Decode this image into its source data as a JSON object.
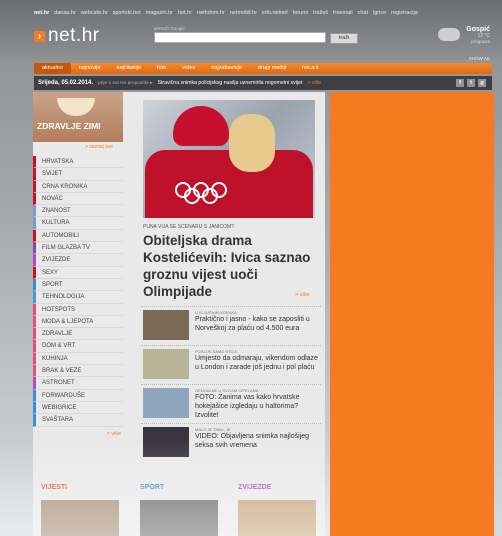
{
  "header": {
    "top_links": [
      "net.hr",
      "danas.hr",
      "webcafe.hr",
      "sportski.net",
      "magazin.hr",
      "hot.hr",
      "nethdom.hr",
      "netmobil.hr",
      "info.netnet",
      "forumi",
      "tražeš",
      "freemail",
      "chat",
      "igrice",
      "registracija"
    ],
    "logo_text": "net.hr",
    "search_label": "pretraži Google",
    "search_placeholder": "",
    "search_button": "traži",
    "weather_city": "Gospić",
    "weather_temp": "12 °C",
    "weather_link": "prognoza",
    "show_ad": "SHOW AD"
  },
  "nav": {
    "tabs": [
      "aktualno",
      "najnovije",
      "najčitanije",
      "foto",
      "video",
      "najzabavnije",
      "drugi mediji",
      "net.a.š"
    ],
    "active_index": 0
  },
  "datebar": {
    "date": "Srijeda, 05.02.2014.",
    "prefix": "prije 1 sat  Ne propustite ▸",
    "headline": "Stravična snimka policijskog nasilja uznemirila nogometni svijet",
    "more": "> više",
    "social": [
      "f",
      "t",
      "g"
    ]
  },
  "promo": {
    "title": "ZDRAVLJE ZIMI",
    "more": "> saznaj sve"
  },
  "sections": {
    "items": [
      "HRVATSKA",
      "SVIJET",
      "CRNA KRONIKA",
      "NOVAC",
      "ZNANOST",
      "KULTURA",
      "AUTOMOBILI",
      "FILM GLAZBA TV",
      "ZVIJEZDE",
      "SEXY",
      "SPORT",
      "TEHNOLOGIJA",
      "HOTSPOTS",
      "MODA & LJEPOTA",
      "ZDRAVLJE",
      "DOM & VRT",
      "KUHINJA",
      "BRAK & VEZE",
      "ASTRONET",
      "FORWARDUŠE",
      "WEBIGRICE",
      "SVAŠTARA"
    ],
    "colors": [
      "#d0101f",
      "#d0101f",
      "#d0101f",
      "#d0101f",
      "#7b9bd0",
      "#7b9bd0",
      "#d0101f",
      "#8a48b5",
      "#b24bc4",
      "#d0101f",
      "#3a8fd8",
      "#3aa0d8",
      "#e35080",
      "#e35080",
      "#e35080",
      "#e35080",
      "#e35080",
      "#e35080",
      "#b24bc4",
      "#3a8fd8",
      "#3a8fd8",
      "#3a8fd8"
    ],
    "more": "> više"
  },
  "hero": {
    "kicker": "PUNA VIJA SE SCENARIJ S JANICOM?",
    "title": "Obiteljska drama Kostelićevih: Ivica saznao groznu vijest uoči Olimpijade",
    "more": "> više"
  },
  "stories": [
    {
      "kicker": "U KLJUČNIM KORAKA",
      "title": "Praktično i jasno - kako se zaposliti u Norveškoj za plaću od 4.500 eura",
      "thumb_color": "#7a6a55"
    },
    {
      "kicker": "POSLIJE SAMO STOJI",
      "title": "Umjesto da odmaraju, vikendom odlaze u London i zarade još jednu i pol plaću",
      "thumb_color": "#b9b39a"
    },
    {
      "kicker": "GENIJALNE U SVOJIM CIPELAMA",
      "title": "FOTO: Zanima vas kako hrvatske hokejašice izgledaju u haltorima? Izvolite!",
      "thumb_color": "#8fa4bd"
    },
    {
      "kicker": "MALO JE TABU, JE",
      "title": "VIDEO: Objavljena snimka najlošijeg seksa svih vremena",
      "thumb_color": "#3a3540"
    }
  ],
  "bottom": [
    {
      "label": "VIJESTI",
      "color": "#e8572a",
      "img_color": "#a88f79"
    },
    {
      "label": "SPORT",
      "color": "#3a8fd8",
      "img_color": "#6f6f72"
    },
    {
      "label": "ZVIJEZDE",
      "color": "#b24bc4",
      "img_color": "#c7a67c"
    }
  ],
  "colors": {
    "accent": "#f47b20",
    "nav_bg": "#e86c16",
    "datebar_bg": "#3d3f42"
  }
}
